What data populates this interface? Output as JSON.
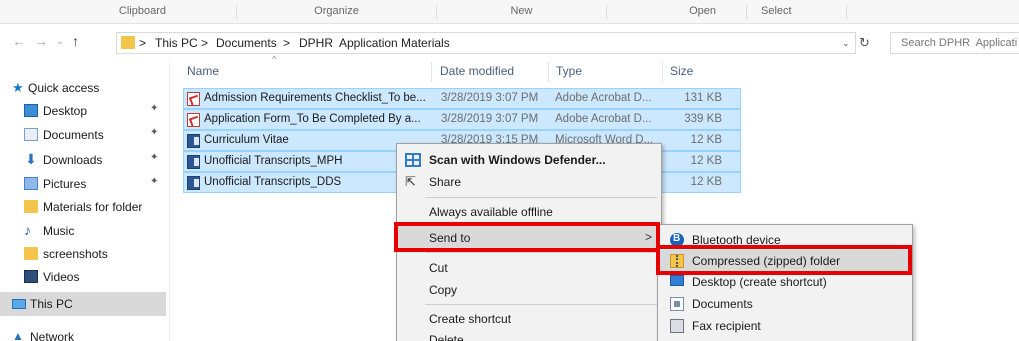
{
  "ribbon": {
    "groups": [
      "Clipboard",
      "Organize",
      "New",
      "Open",
      "Select"
    ]
  },
  "address": {
    "back_icon": "back-arrow-icon",
    "forward_icon": "forward-arrow-icon",
    "up_icon": "up-arrow-icon",
    "separator": ">",
    "crumbs": [
      "This PC",
      "Documents",
      "DPHR  Application Materials"
    ],
    "dropdown_glyph": "⌄",
    "refresh_glyph": "↻",
    "search_placeholder": "Search DPHR  Applicati"
  },
  "nav": {
    "items": [
      {
        "label": "Quick access",
        "icon": "star-icon",
        "pinned": false
      },
      {
        "label": "Desktop",
        "icon": "desktop-icon",
        "pinned": true
      },
      {
        "label": "Documents",
        "icon": "documents-icon",
        "pinned": true
      },
      {
        "label": "Downloads",
        "icon": "downloads-icon",
        "pinned": true
      },
      {
        "label": "Pictures",
        "icon": "pictures-icon",
        "pinned": true
      },
      {
        "label": "Materials for folder",
        "icon": "folder-icon",
        "pinned": false
      },
      {
        "label": "Music",
        "icon": "music-icon",
        "pinned": false
      },
      {
        "label": "screenshots",
        "icon": "folder-icon",
        "pinned": false
      },
      {
        "label": "Videos",
        "icon": "videos-icon",
        "pinned": false
      },
      {
        "label": "This PC",
        "icon": "this-pc-icon",
        "pinned": false,
        "selected": true
      },
      {
        "label": "Network",
        "icon": "network-icon",
        "pinned": false
      }
    ],
    "pin_glyph": "✦"
  },
  "columns": [
    "Name",
    "Date modified",
    "Type",
    "Size"
  ],
  "files": [
    {
      "name": "Admission Requirements Checklist_To be...",
      "date": "3/28/2019 3:07 PM",
      "type": "Adobe Acrobat D...",
      "size": "131 KB",
      "icon": "pdf-icon"
    },
    {
      "name": "Application Form_To Be Completed By a...",
      "date": "3/28/2019 3:07 PM",
      "type": "Adobe Acrobat D...",
      "size": "339 KB",
      "icon": "pdf-icon"
    },
    {
      "name": "Curriculum Vitae",
      "date": "3/28/2019 3:15 PM",
      "type": "Microsoft Word D...",
      "size": "12 KB",
      "icon": "word-icon"
    },
    {
      "name": "Unofficial Transcripts_MPH",
      "date": "",
      "type": "",
      "size": "12 KB",
      "icon": "word-icon"
    },
    {
      "name": "Unofficial Transcripts_DDS",
      "date": "",
      "type": "",
      "size": "12 KB",
      "icon": "word-icon"
    }
  ],
  "context_menu": {
    "items": [
      {
        "label": "Scan with Windows Defender...",
        "bold": true
      },
      {
        "label": "Share"
      },
      {
        "label": "Always available offline"
      },
      {
        "label": "Send to",
        "has_submenu": true
      },
      {
        "label": "Cut"
      },
      {
        "label": "Copy"
      },
      {
        "label": "Create shortcut"
      },
      {
        "label": "Delete"
      }
    ],
    "submenu_arrow": ">"
  },
  "send_to_menu": {
    "items": [
      {
        "label": "Bluetooth device"
      },
      {
        "label": "Compressed (zipped) folder"
      },
      {
        "label": "Desktop (create shortcut)"
      },
      {
        "label": "Documents"
      },
      {
        "label": "Fax recipient"
      }
    ]
  },
  "colors": {
    "selection_fill": "#cce8ff",
    "selection_border": "#99d1ff",
    "highlight_box": "#e60000",
    "menu_bg": "#f2f2f2",
    "menu_hover": "#d9d9d9"
  }
}
